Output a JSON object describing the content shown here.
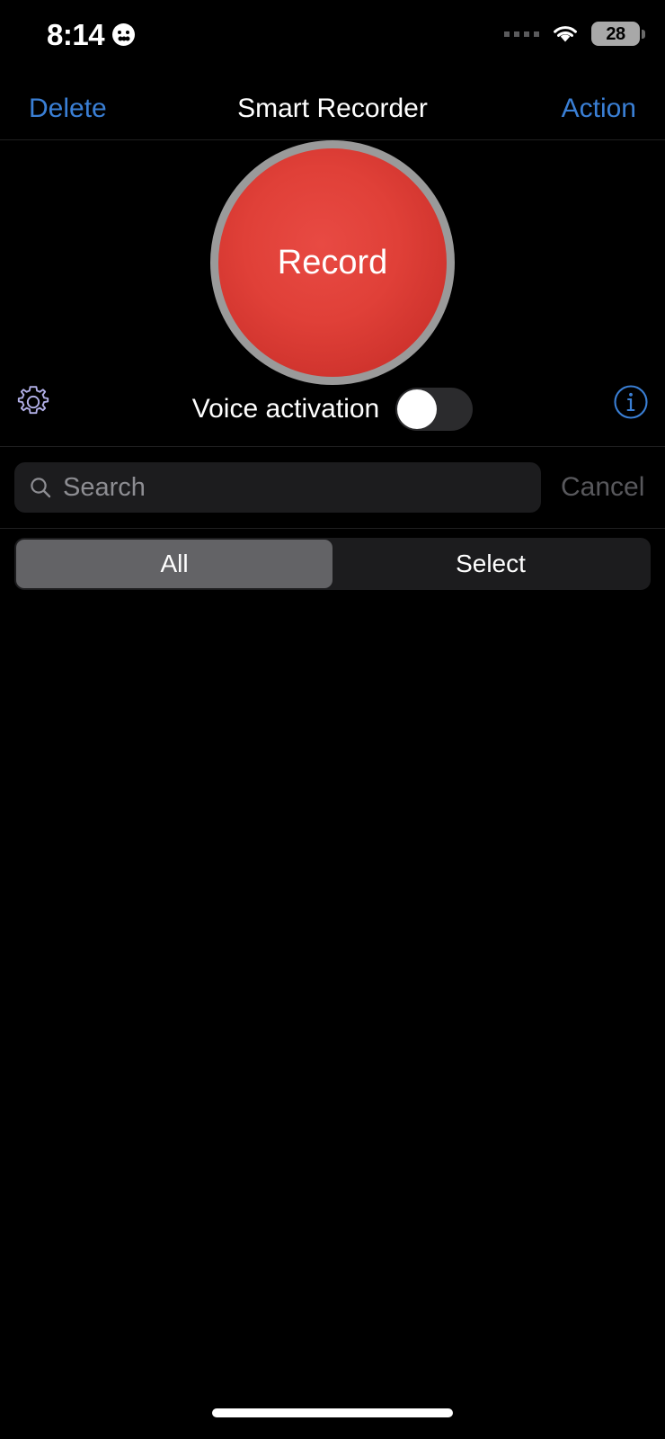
{
  "status_bar": {
    "time": "8:14",
    "focus_icon": "smiley-face-icon",
    "cellular_icon": "signal-dots-icon",
    "wifi_icon": "wifi-icon",
    "battery_level": "28",
    "battery_icon": "battery-icon"
  },
  "nav_bar": {
    "left_button": "Delete",
    "title": "Smart Recorder",
    "right_button": "Action",
    "tint_color": "#3a7fd5"
  },
  "record": {
    "label": "Record",
    "fill_color": "#e0403a",
    "ring_color": "#9a9a9a"
  },
  "controls": {
    "settings_icon": "gear-icon",
    "settings_color": "#b2b0e8",
    "info_icon": "info-circle-icon",
    "info_color": "#3a7fd5",
    "voice_activation_label": "Voice activation",
    "voice_activation_state": "off"
  },
  "search": {
    "placeholder": "Search",
    "value": "",
    "icon": "search-icon",
    "cancel_label": "Cancel"
  },
  "segmented": {
    "options": [
      {
        "label": "All",
        "selected": true
      },
      {
        "label": "Select",
        "selected": false
      }
    ],
    "selected_color": "#636366"
  },
  "list": {
    "items": []
  },
  "home_indicator": "home-indicator"
}
